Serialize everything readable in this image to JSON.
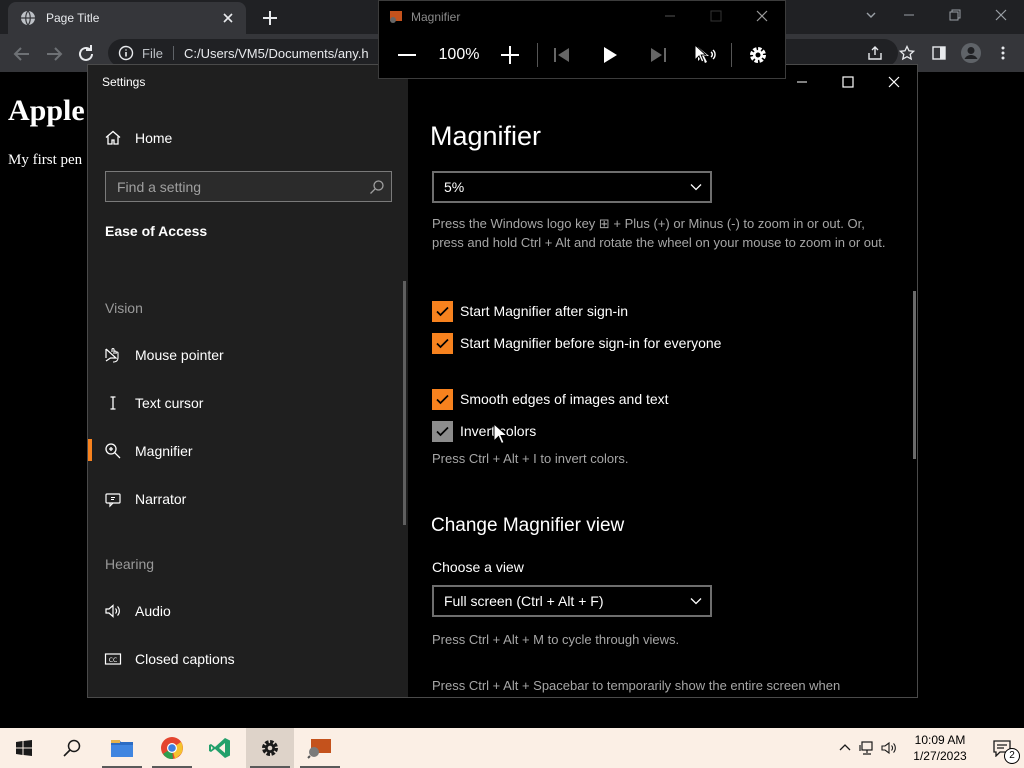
{
  "browser": {
    "tab_title": "Page Title",
    "address_label": "File",
    "address_url": "C:/Users/VM5/Documents/any.h",
    "page_heading": "Apple",
    "page_text": "My first pen"
  },
  "settings": {
    "window_title": "Settings",
    "home_label": "Home",
    "search_placeholder": "Find a setting",
    "section_title": "Ease of Access",
    "groups": {
      "vision": "Vision",
      "hearing": "Hearing"
    },
    "nav_items": [
      {
        "label": "Mouse pointer",
        "icon": "mouse-pointer-icon"
      },
      {
        "label": "Text cursor",
        "icon": "text-cursor-icon"
      },
      {
        "label": "Magnifier",
        "icon": "magnifier-icon",
        "selected": true
      },
      {
        "label": "Narrator",
        "icon": "narrator-icon"
      },
      {
        "label": "Audio",
        "icon": "audio-icon"
      },
      {
        "label": "Closed captions",
        "icon": "closed-captions-icon"
      }
    ],
    "content": {
      "title": "Magnifier",
      "zoom_increment": "5%",
      "zoom_help_1": "Press the Windows logo key ⊞ + Plus (+) or Minus (-) to zoom in or out. Or, press and hold Ctrl + Alt and rotate the wheel on your mouse to zoom in or out.",
      "checkboxes": [
        {
          "label": "Start Magnifier after sign-in",
          "checked": true
        },
        {
          "label": "Start Magnifier before sign-in for everyone",
          "checked": true
        },
        {
          "label": "Smooth edges of images and text",
          "checked": true
        },
        {
          "label": "Invert colors",
          "checked": true
        }
      ],
      "invert_help": "Press Ctrl + Alt + I to invert colors.",
      "view_title": "Change Magnifier view",
      "view_label": "Choose a view",
      "view_value": "Full screen (Ctrl + Alt + F)",
      "view_help_1": "Press Ctrl + Alt + M to cycle through views.",
      "view_help_2": "Press Ctrl + Alt + Spacebar to temporarily show the entire screen when"
    }
  },
  "magnifier": {
    "title": "Magnifier",
    "zoom": "100%"
  },
  "taskbar": {
    "time": "10:09 AM",
    "date": "1/27/2023",
    "notification_count": "2"
  },
  "colors": {
    "accent": "#f7821e",
    "nav_bg": "#1f1f1f",
    "content_bg": "#000000",
    "taskbar_bg": "#fbefe5"
  }
}
